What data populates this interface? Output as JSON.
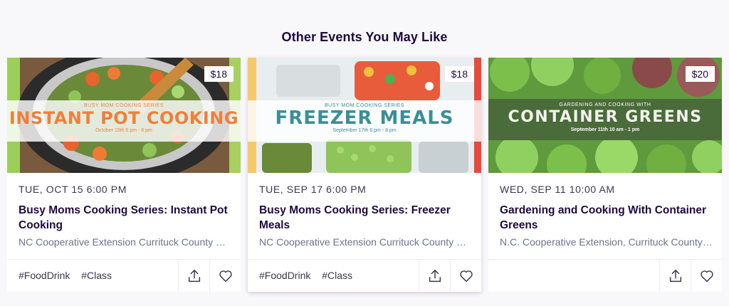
{
  "section": {
    "title": "Other Events You May Like"
  },
  "events": [
    {
      "price": "$18",
      "image_caption": {
        "subtitle": "BUSY MOM COOKING SERIES",
        "title": "INSTANT POT COOKING",
        "date": "October 15th 6 pm - 8 pm"
      },
      "date": "TUE, OCT 15 6:00 PM",
      "title": "Busy Moms Cooking Series: Instant Pot Cooking",
      "organizer": "NC Cooperative Extension Currituck County Center",
      "tags": [
        "#FoodDrink",
        "#Class"
      ]
    },
    {
      "price": "$18",
      "image_caption": {
        "subtitle": "BUSY MOM COOKING SERIES",
        "title": "FREEZER MEALS",
        "date": "September 17th 6 pm - 8 pm"
      },
      "date": "TUE, SEP 17 6:00 PM",
      "title": "Busy Moms Cooking Series: Freezer Meals",
      "organizer": "NC Cooperative Extension Currituck County Center",
      "tags": [
        "#FoodDrink",
        "#Class"
      ]
    },
    {
      "price": "$20",
      "image_caption": {
        "subtitle": "GARDENING AND COOKING WITH",
        "title": "CONTAINER GREENS",
        "date": "September 11th 10 am - 1 pm"
      },
      "date": "WED, SEP 11 10:00 AM",
      "title": "Gardening and Cooking With Container Greens",
      "organizer": "N.C. Cooperative Extension, Currituck County Center",
      "tags": []
    }
  ],
  "colors": {
    "page_bg": "#f8f7fa",
    "title_text": "#1e0a3c",
    "card_text_muted": "#6f7287",
    "instant_pot_caption": "#f07f3c",
    "freezer_caption": "#3a8f97",
    "greens_band": "#4a6b3a"
  },
  "icons": {
    "share": "share-upload-icon",
    "like": "heart-outline-icon"
  }
}
